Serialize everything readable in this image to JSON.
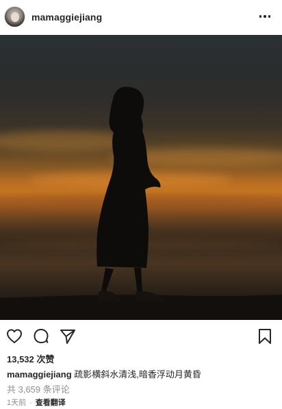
{
  "post": {
    "username": "mamaggiejiang",
    "likes": "13,532 次赞",
    "caption_user": "mamaggiejiang",
    "caption_text": "疏影横斜水清浅,暗香浮动月黄昏",
    "comments": "共 3,659 条评论",
    "time": "1天前",
    "separator": "·",
    "translate": "查看翻译"
  },
  "icons": {
    "more": "more-options-icon",
    "like": "heart-icon",
    "comment": "comment-icon",
    "share": "send-icon",
    "save": "bookmark-icon"
  }
}
